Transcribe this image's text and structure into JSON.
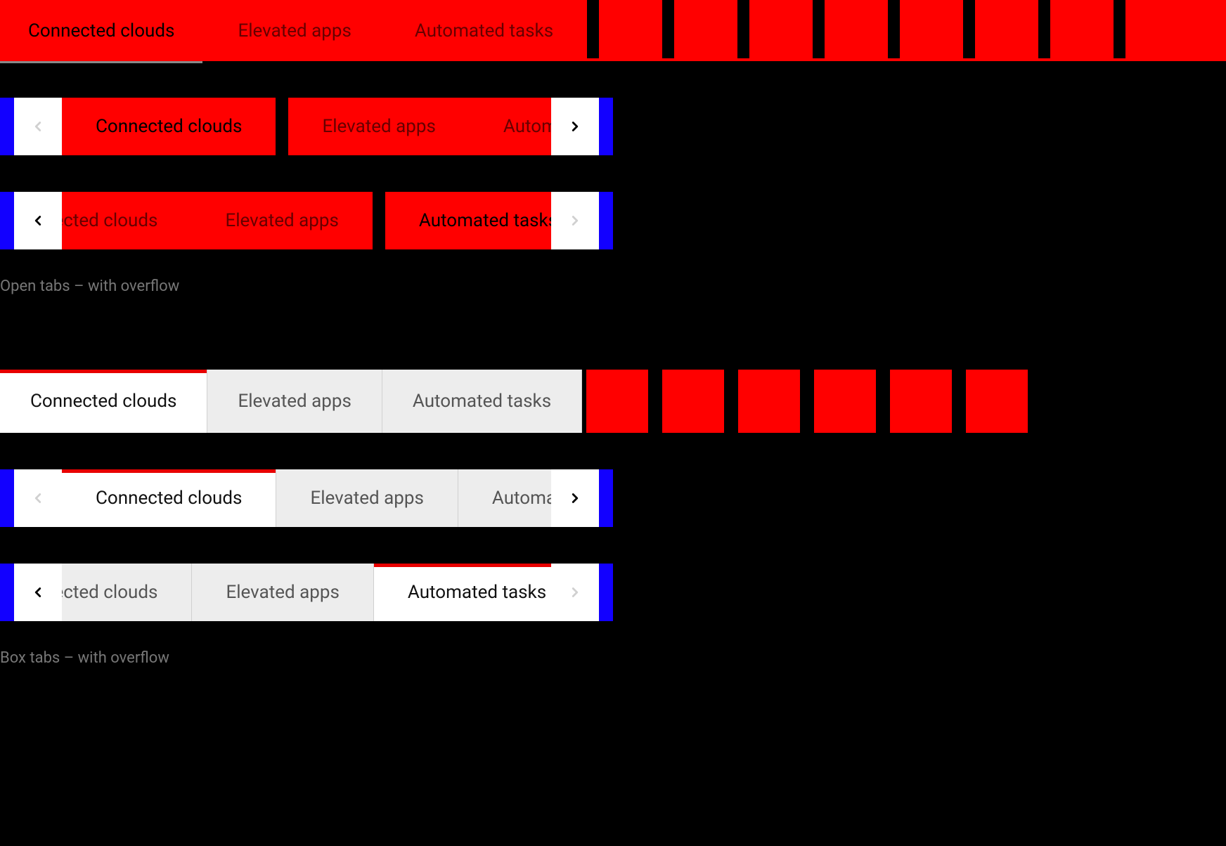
{
  "tabs": {
    "t1": "Connected clouds",
    "t2": "Elevated apps",
    "t3": "Automated tasks"
  },
  "labels": {
    "open_overflow": "Open tabs – with overflow",
    "box_overflow": "Box tabs – with overflow"
  },
  "icons": {
    "chevron_left": "chevron-left-icon",
    "chevron_right": "chevron-right-icon"
  }
}
